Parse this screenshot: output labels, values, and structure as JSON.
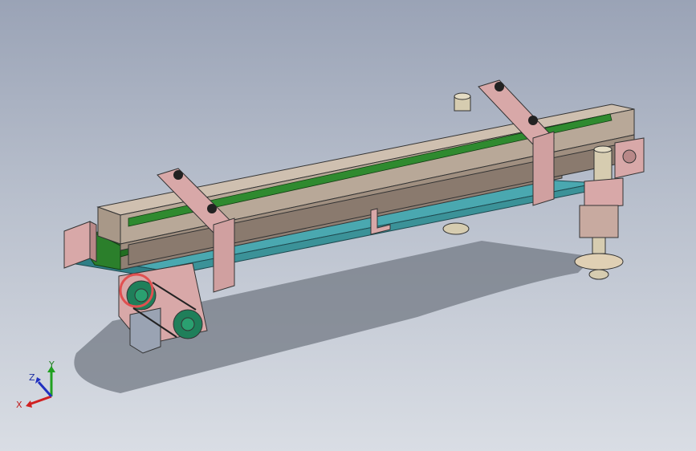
{
  "viewport": {
    "background_top": "#9aa3b6",
    "background_bottom": "#d9dde4"
  },
  "model": {
    "belt_color": "#2f8a2f",
    "frame_color": "#b8a898",
    "bracket_color": "#d8a8a8",
    "base_color": "#4aa8b0",
    "shadow_color": "#6c727c"
  },
  "triad": {
    "x_label": "X",
    "y_label": "Y",
    "z_label": "Z",
    "x_color": "#d02020",
    "y_color": "#20a020",
    "z_color": "#2030c0"
  }
}
